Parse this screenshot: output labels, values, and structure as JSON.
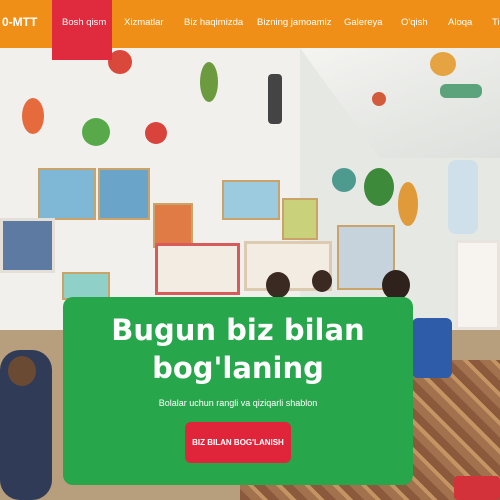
{
  "header": {
    "logo_text": "0-MTT",
    "nav": [
      {
        "label": "Bosh qism"
      },
      {
        "label": "Xizmatlar"
      },
      {
        "label": "Biz haqimizda"
      },
      {
        "label": "Bizning jamoamiz"
      },
      {
        "label": "Galereya"
      },
      {
        "label": "O'qish"
      },
      {
        "label": "Aloqa"
      },
      {
        "label": "Ti"
      }
    ]
  },
  "hero": {
    "title_line1": "Bugun biz bilan",
    "title_line2": "bog'laning",
    "subtitle": "Bolalar uchun rangli va qiziqarli shablon",
    "cta_label": "BIZ BILAN BOG'LANISH"
  },
  "colors": {
    "navbar": "#ef8f17",
    "active_nav": "#e02a3d",
    "hero_card": "#27a64b",
    "cta_button": "#e0243a",
    "text": "#ffffff"
  }
}
